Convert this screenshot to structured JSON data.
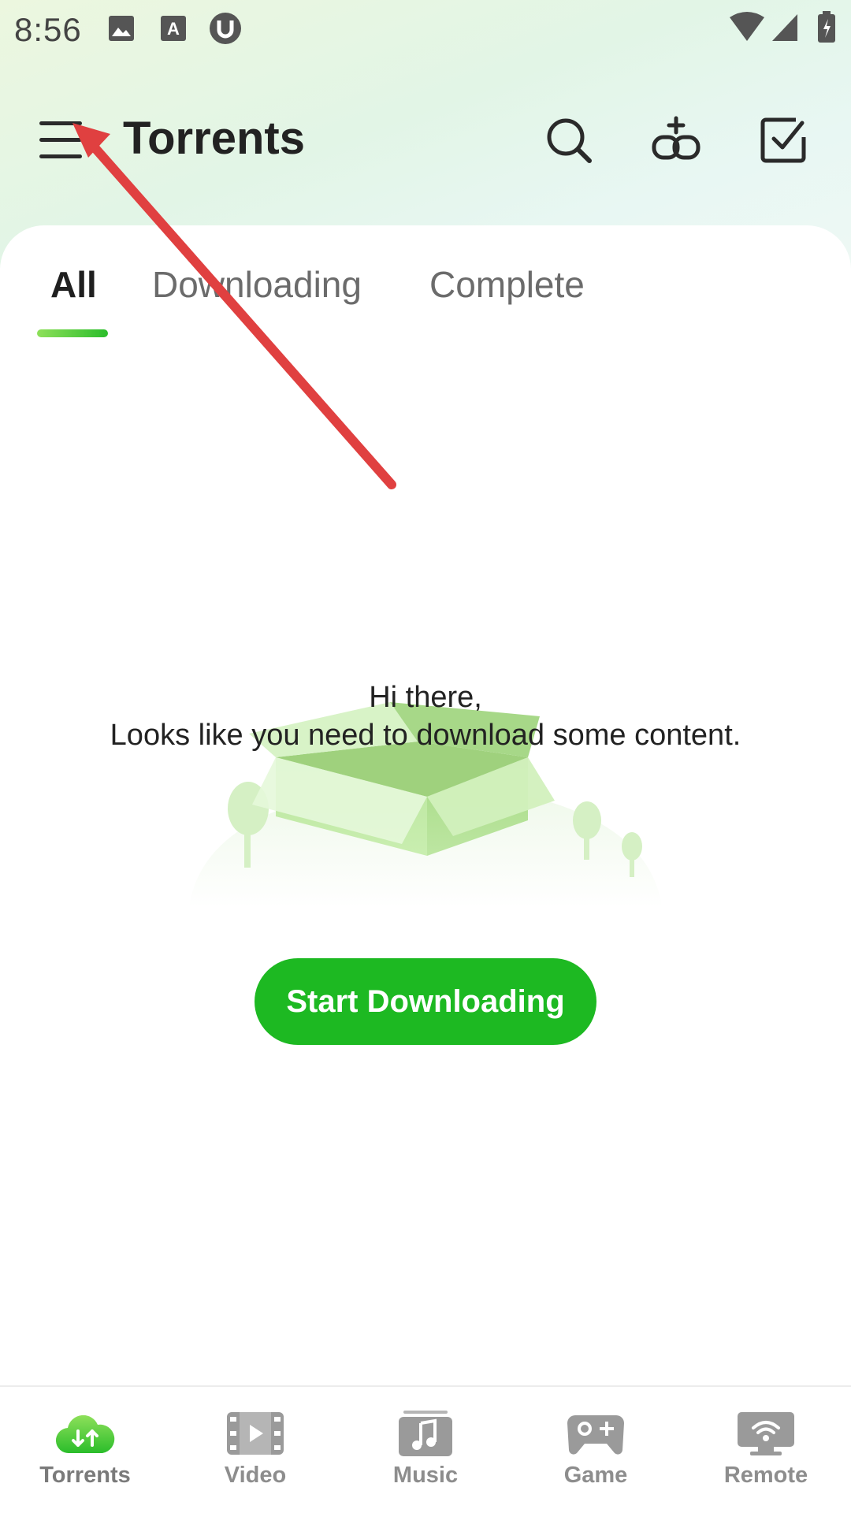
{
  "status_bar": {
    "time": "8:56",
    "left_icons": [
      "image-icon",
      "font-a-icon",
      "utorrent-icon"
    ],
    "right_icons": [
      "wifi-icon",
      "signal-icon",
      "battery-icon"
    ]
  },
  "header": {
    "title": "Torrents",
    "actions": [
      "search-icon",
      "add-link-icon",
      "select-checkbox-icon"
    ]
  },
  "tabs": [
    {
      "label": "All",
      "active": true
    },
    {
      "label": "Downloading",
      "active": false
    },
    {
      "label": "Complete",
      "active": false
    }
  ],
  "empty_state": {
    "line1": "Hi there,",
    "line2": "Looks like you need to download some content.",
    "button_label": "Start Downloading"
  },
  "bottom_nav": [
    {
      "label": "Torrents",
      "icon": "cloud-transfer-icon",
      "active": true
    },
    {
      "label": "Video",
      "icon": "video-icon",
      "active": false
    },
    {
      "label": "Music",
      "icon": "music-icon",
      "active": false
    },
    {
      "label": "Game",
      "icon": "gamepad-icon",
      "active": false
    },
    {
      "label": "Remote",
      "icon": "remote-wifi-icon",
      "active": false
    }
  ],
  "colors": {
    "accent": "#1db922",
    "annotation_arrow": "#e04040",
    "header_gradient": "#e2f5e6"
  }
}
